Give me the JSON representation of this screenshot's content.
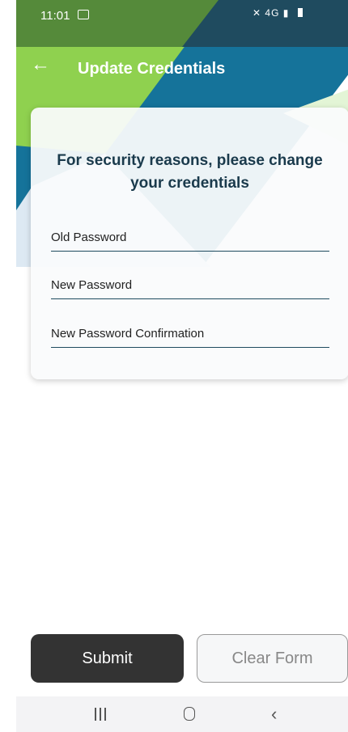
{
  "status_bar": {
    "time": "11:01",
    "gallery_icon": "image-icon",
    "network_text": "4G",
    "icons": [
      "mute-icon",
      "signal-icon",
      "battery-icon"
    ]
  },
  "app_bar": {
    "back_icon": "arrow-left-icon",
    "title": "Update Credentials"
  },
  "card": {
    "heading": "For security reasons, please change your credentials",
    "fields": [
      {
        "label": "Old Password",
        "value": ""
      },
      {
        "label": "New Password",
        "value": ""
      },
      {
        "label": "New Password Confirmation",
        "value": ""
      }
    ]
  },
  "actions": {
    "submit_label": "Submit",
    "clear_label": "Clear Form"
  },
  "nav_bar": {
    "icons": [
      "recent-apps-icon",
      "home-icon",
      "back-icon"
    ]
  },
  "colors": {
    "dark_teal": "#1f4b5f",
    "blue": "#15739a",
    "green": "#8fd14f",
    "light_green": "#e3f5d6",
    "button_dark": "#333333"
  }
}
